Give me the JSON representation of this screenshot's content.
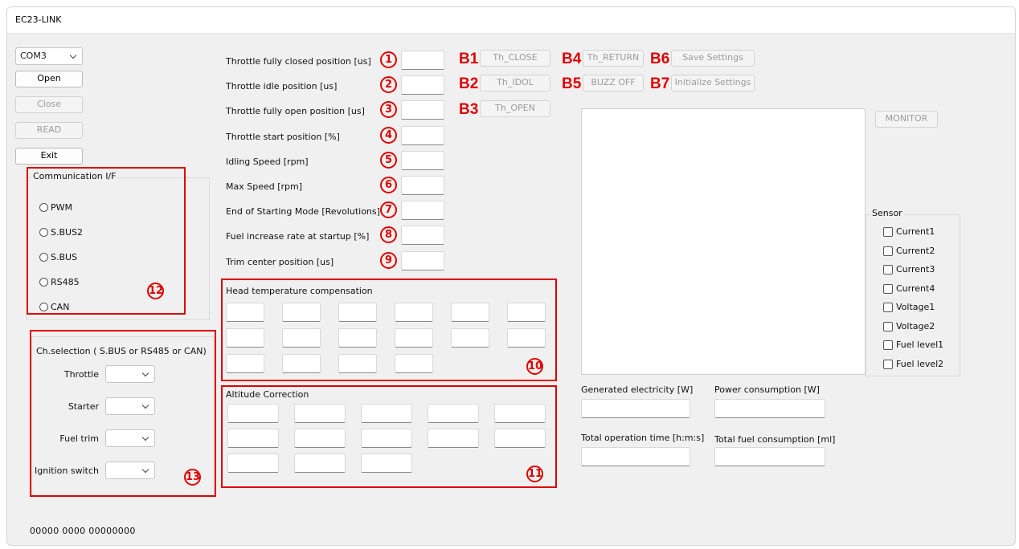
{
  "window": {
    "title": "EC23-LINK"
  },
  "port": {
    "selected": "COM3"
  },
  "buttons": {
    "open": "Open",
    "close": "Close",
    "read": "READ",
    "exit": "Exit",
    "th_close": "Th_CLOSE",
    "th_idol": "Th_IDOL",
    "th_open": "Th_OPEN",
    "th_return": "Th_RETURN",
    "buzz_off": "BUZZ OFF",
    "save_settings": "Save Settings",
    "init_settings": "Initialize Settings",
    "monitor": "MONITOR"
  },
  "button_markers": {
    "b1": "B1",
    "b2": "B2",
    "b3": "B3",
    "b4": "B4",
    "b5": "B5",
    "b6": "B6",
    "b7": "B7"
  },
  "params": [
    {
      "label": "Throttle fully closed position [us]",
      "marker": "1",
      "value": ""
    },
    {
      "label": "Throttle idle position [us]",
      "marker": "2",
      "value": ""
    },
    {
      "label": "Throttle fully open position [us]",
      "marker": "3",
      "value": ""
    },
    {
      "label": "Throttle start position [%]",
      "marker": "4",
      "value": ""
    },
    {
      "label": "Idling Speed [rpm]",
      "marker": "5",
      "value": ""
    },
    {
      "label": "Max Speed [rpm]",
      "marker": "6",
      "value": ""
    },
    {
      "label": "End of Starting Mode [Revolutions]",
      "marker": "7",
      "value": ""
    },
    {
      "label": "Fuel increase rate at startup [%]",
      "marker": "8",
      "value": ""
    },
    {
      "label": "Trim center position [us]",
      "marker": "9",
      "value": ""
    }
  ],
  "comm": {
    "title": "Communication I/F",
    "options": [
      "PWM",
      "S.BUS2",
      "S.BUS",
      "RS485",
      "CAN"
    ],
    "marker": "12"
  },
  "channels": {
    "title": "Ch.selection ( S.BUS or RS485 or CAN)",
    "items": [
      "Throttle",
      "Starter",
      "Fuel trim",
      "Ignition switch"
    ],
    "marker": "13"
  },
  "head_temp": {
    "title": "Head temperature compensation",
    "marker": "10"
  },
  "altitude": {
    "title": "Altitude Correction",
    "marker": "11"
  },
  "readouts": {
    "generated": "Generated electricity [W]",
    "power": "Power consumption [W]",
    "op_time": "Total operation time [h:m:s]",
    "fuel": "Total fuel consumption [ml]"
  },
  "sensor": {
    "title": "Sensor",
    "items": [
      "Current1",
      "Current2",
      "Current3",
      "Current4",
      "Voltage1",
      "Voltage2",
      "Fuel level1",
      "Fuel level2"
    ]
  },
  "status": {
    "text": "00000  0000  00000000"
  }
}
